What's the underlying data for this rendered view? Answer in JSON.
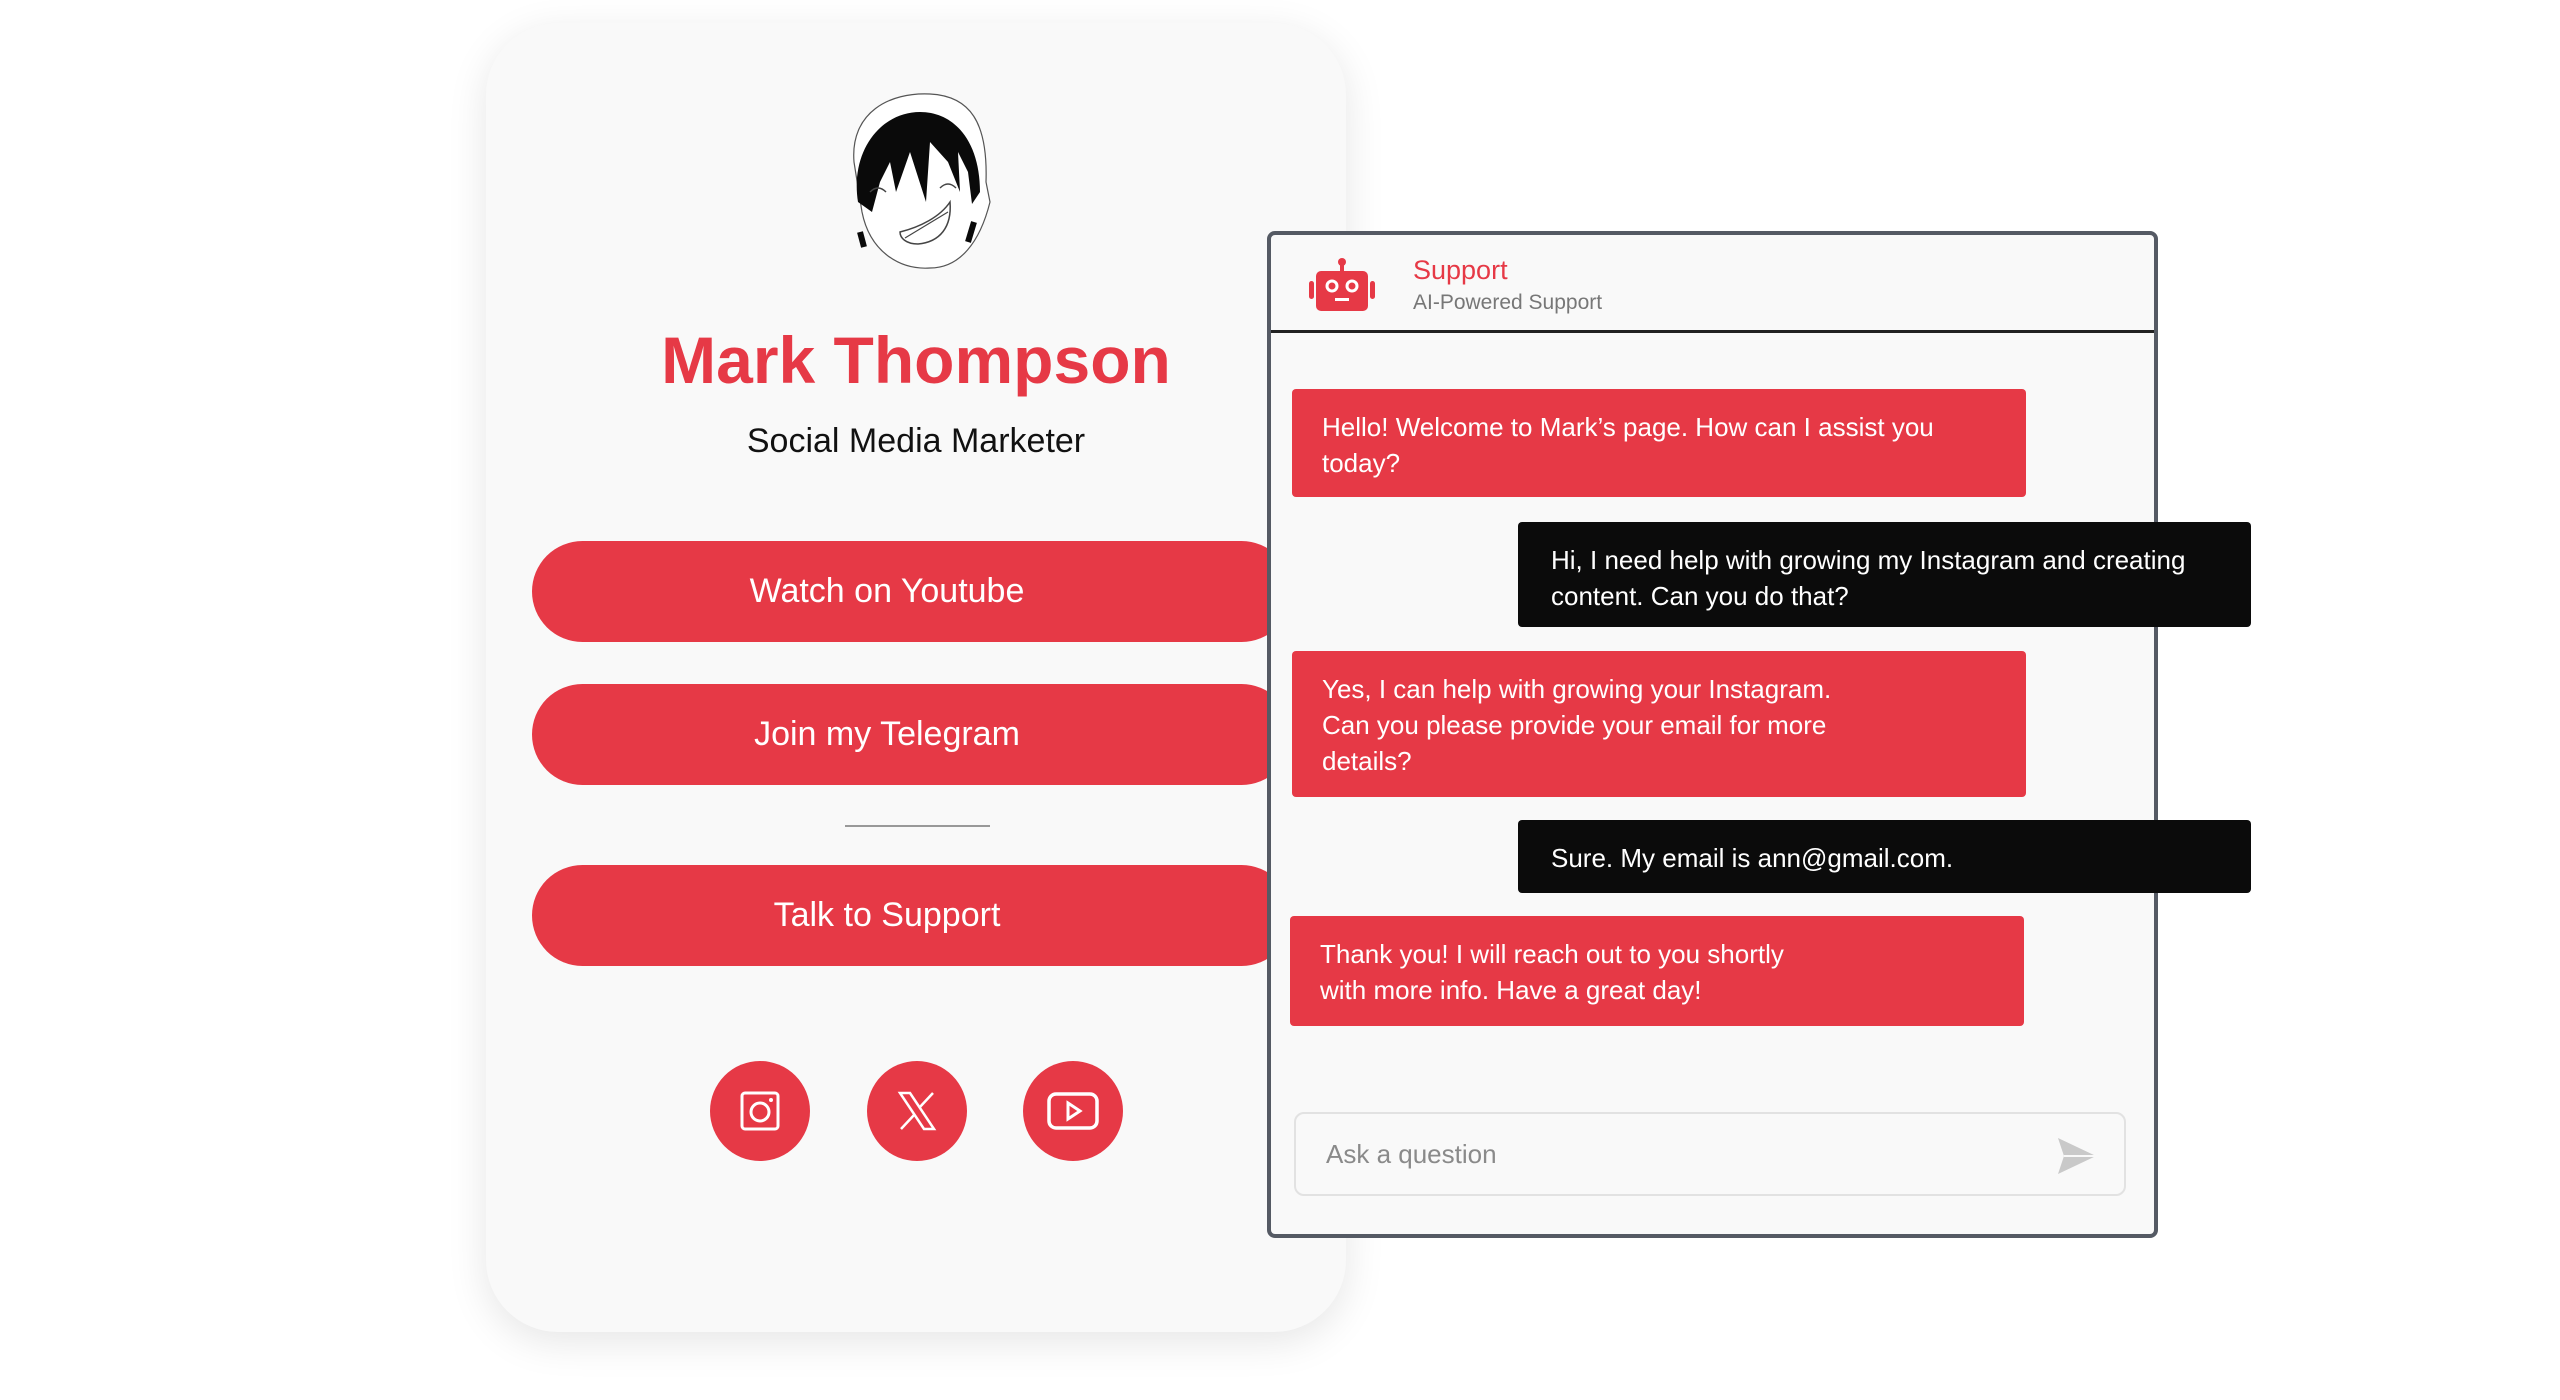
{
  "profile": {
    "name": "Mark Thompson",
    "role": "Social Media Marketer"
  },
  "buttons": {
    "youtube": "Watch on Youtube",
    "telegram": "Join my Telegram",
    "support": "Talk to Support"
  },
  "social": [
    "instagram-icon",
    "x-icon",
    "youtube-icon"
  ],
  "chat": {
    "title": "Support",
    "subtitle": "AI-Powered Support",
    "messages": [
      {
        "from": "bot",
        "text": "Hello! Welcome to Mark’s page. How can I assist you today?"
      },
      {
        "from": "user",
        "text": "Hi, I need help with growing my Instagram and creating content. Can you do that?"
      },
      {
        "from": "bot",
        "text": "Yes, I can help with growing your Instagram. Can you please provide your email for more details?"
      },
      {
        "from": "user",
        "text": "Sure. My email is ann@gmail.com."
      },
      {
        "from": "bot",
        "text": "Thank you! I will reach out to you shortly with more info. Have a great day!"
      }
    ],
    "input_placeholder": "Ask a question"
  },
  "colors": {
    "accent": "#e63946",
    "user_bubble": "#0b0b0b",
    "card_bg": "#f9f9f9"
  }
}
